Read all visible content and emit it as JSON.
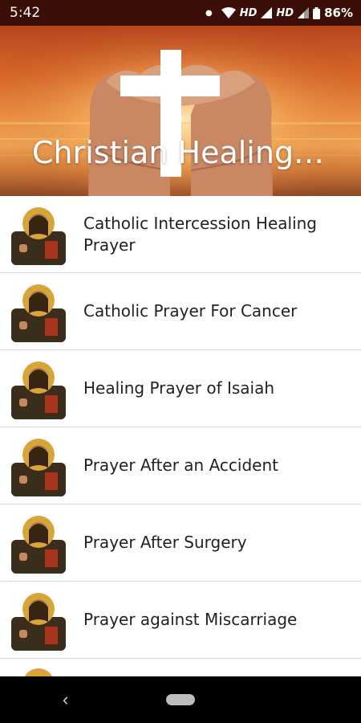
{
  "status_bar": {
    "time": "5:42",
    "hd1": "HD",
    "hd2": "HD",
    "battery": "86%"
  },
  "header": {
    "title": "Christian Healing…"
  },
  "prayers": [
    {
      "label": "Catholic Intercession Healing Prayer"
    },
    {
      "label": "Catholic Prayer For Cancer"
    },
    {
      "label": "Healing Prayer of Isaiah"
    },
    {
      "label": "Prayer After an Accident"
    },
    {
      "label": "Prayer After Surgery"
    },
    {
      "label": "Prayer against Miscarriage"
    }
  ],
  "icons": {
    "thumbnail": "jesus-icon-image",
    "back": "back-chevron-icon",
    "home": "home-pill-icon"
  },
  "colors": {
    "status_bar": "#3b0f07",
    "nav_bar": "#000000",
    "divider": "#dcdcdc"
  }
}
